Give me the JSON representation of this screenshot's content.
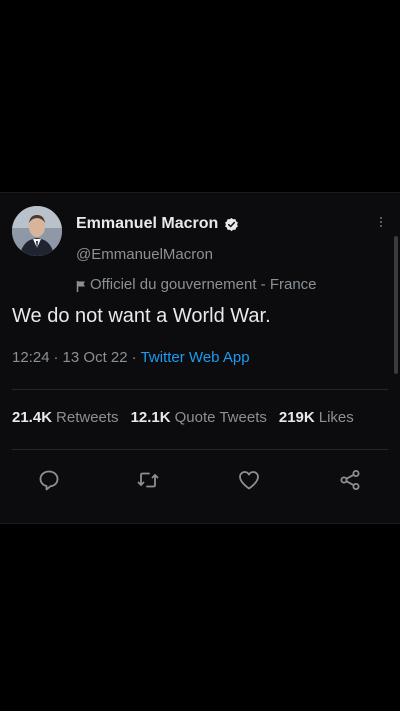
{
  "tweet": {
    "author": {
      "name": "Emmanuel Macron",
      "handle": "@EmmanuelMacron",
      "label": "Officiel du gouvernement - France"
    },
    "text": "We do not want a World War.",
    "time": "12:24",
    "separator1": "·",
    "date": "13 Oct 22",
    "separator2": "·",
    "source": "Twitter Web App",
    "stats": {
      "retweets_count": "21.4K",
      "retweets_label": "Retweets",
      "quotes_count": "12.1K",
      "quotes_label": "Quote Tweets",
      "likes_count": "219K",
      "likes_label": "Likes"
    },
    "actions": [
      "reply-icon",
      "retweet-icon",
      "like-icon",
      "share-icon"
    ]
  },
  "colors": {
    "background": "#000000",
    "text": "#e7e9ea",
    "secondary": "#8b9096",
    "link": "#1d9bf0",
    "verified": "#e7e9ea"
  }
}
